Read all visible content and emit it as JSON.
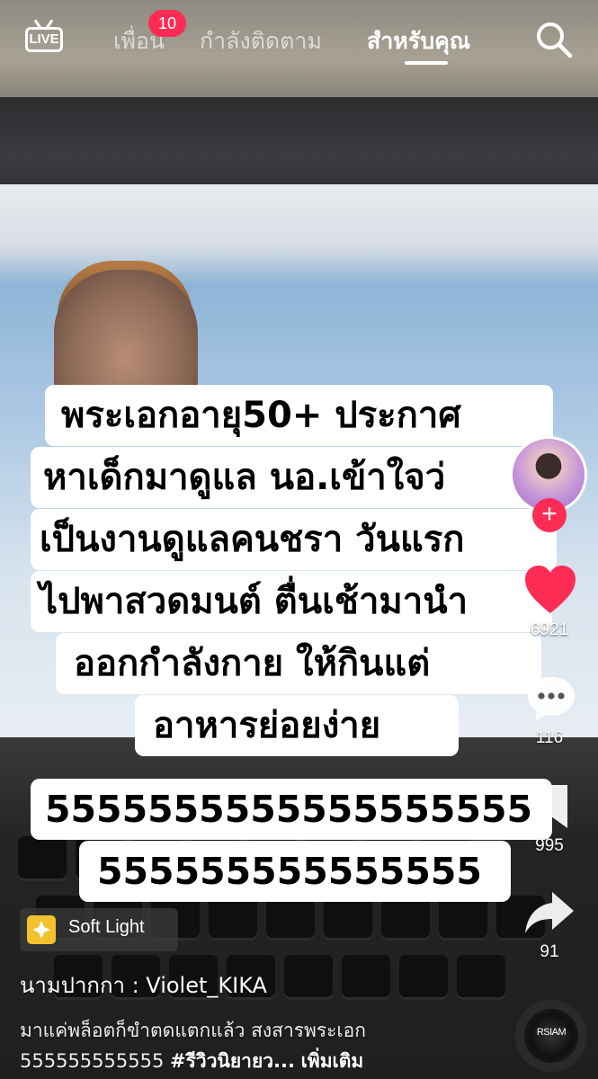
{
  "topnav": {
    "live_label": "LIVE",
    "tabs": [
      {
        "label": "เพื่อน"
      },
      {
        "label": "กำลังติดตาม"
      },
      {
        "label": "สำหรับคุณ",
        "active": true
      }
    ],
    "friends_badge": "10"
  },
  "caption": {
    "lines": [
      "พระเอกอายุ50+ ประกาศ",
      "หาเด็กมาดูแล นอ.เข้าใจว่",
      "เป็นงานดูแลคนชรา วันแรก",
      "ไปพาสวดมนต์ ตื่นเช้ามานำ",
      "ออกกำลังกาย ให้กินแต่",
      "อาหารย่อยง่าย",
      "5555555555555555555",
      "555555555555555"
    ]
  },
  "actions": {
    "likes": "6921",
    "comments": "116",
    "saves": "995",
    "shares": "91"
  },
  "effect": {
    "label": "Soft Light"
  },
  "post": {
    "username": "นามปากกา : Violet_KIKA",
    "description_line1": "มาแค่พล็อตก็ขำตดแตกแล้ว สงสารพระเอก",
    "description_line2_text": "555555555555",
    "hashtag": "#รีวิวนิยายว...",
    "more_label": "เพิ่มเติม"
  },
  "music": {
    "disc_label": "RSIAM"
  },
  "colors": {
    "accent": "#fe2c55",
    "text_on_video": "#ffffff",
    "caption_bg": "#ffffff"
  },
  "icons": [
    "live-icon",
    "search-icon",
    "heart-icon",
    "comment-icon",
    "bookmark-icon",
    "share-icon",
    "effect-icon",
    "music-disc-icon"
  ]
}
